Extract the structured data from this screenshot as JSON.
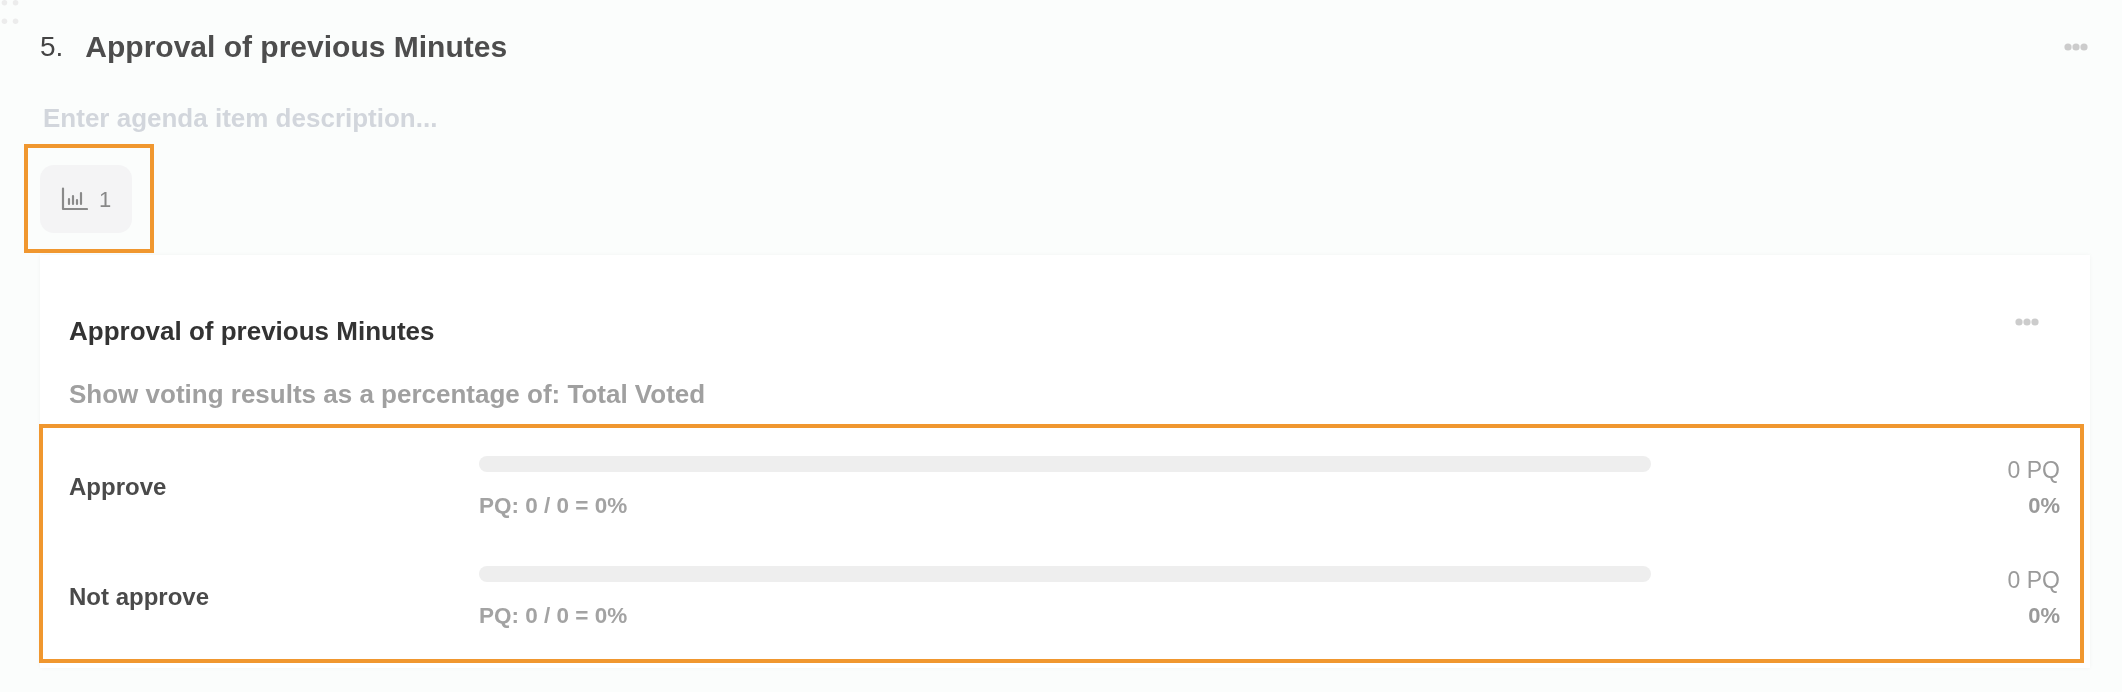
{
  "agenda_item": {
    "number": "5.",
    "title": "Approval of previous Minutes",
    "description": {
      "placeholder": "Enter agenda item description..."
    },
    "poll_badge": {
      "count": "1",
      "highlighted": true
    }
  },
  "poll": {
    "title": "Approval of previous Minutes",
    "basis": "Show voting results as a percentage of: Total Voted",
    "results_highlighted": true,
    "options": [
      {
        "label": "Approve",
        "level": 0,
        "formula": "PQ: 0 / 0 = 0%",
        "votes": "0 PQ",
        "percent": "0%"
      },
      {
        "label": "Not approve",
        "level": 0,
        "formula": "PQ: 0 / 0 = 0%",
        "votes": "0 PQ",
        "percent": "0%"
      }
    ]
  }
}
